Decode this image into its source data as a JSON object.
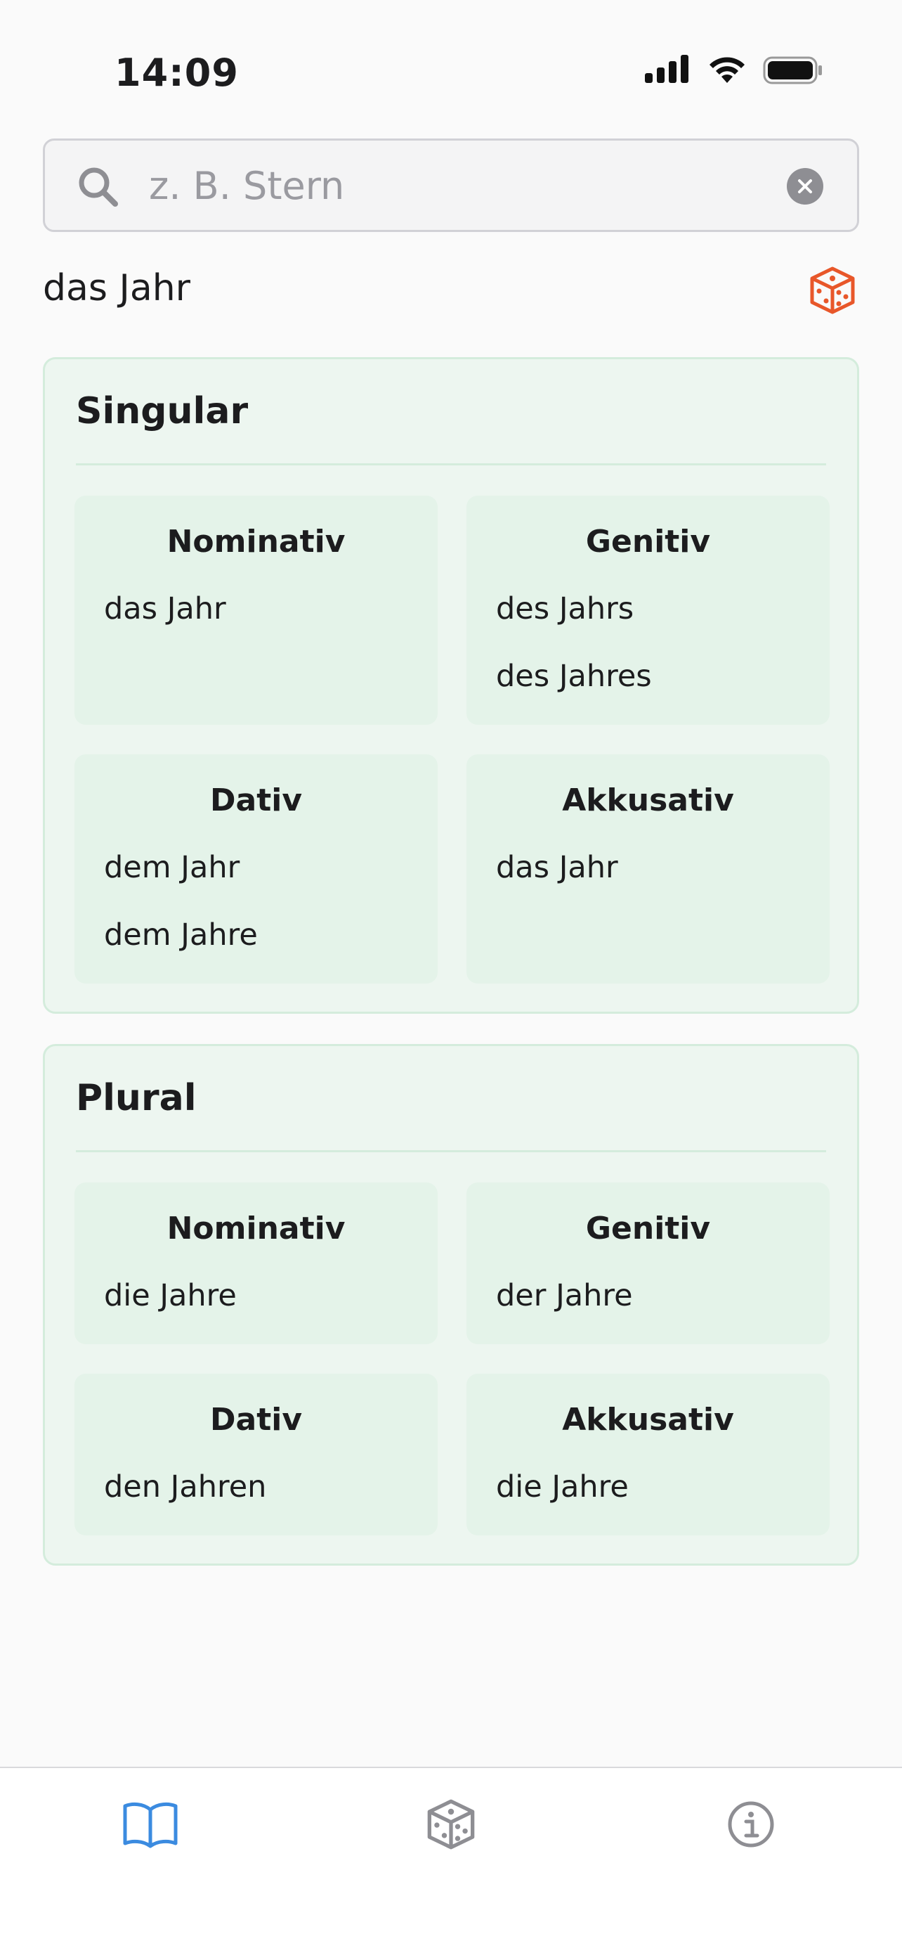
{
  "status_bar": {
    "time": "14:09"
  },
  "search": {
    "placeholder": "z. B. Stern",
    "value": ""
  },
  "word": {
    "title": "das Jahr"
  },
  "colors": {
    "accent": "#e8572a",
    "tab_active": "#3b8be0",
    "tab_inactive": "#8e8e93",
    "card_bg": "#edf6f0",
    "cell_bg": "#e4f3e9"
  },
  "singular": {
    "title": "Singular",
    "nominativ": {
      "label": "Nominativ",
      "forms": [
        "das Jahr"
      ]
    },
    "genitiv": {
      "label": "Genitiv",
      "forms": [
        "des Jahrs",
        "des Jahres"
      ]
    },
    "dativ": {
      "label": "Dativ",
      "forms": [
        "dem Jahr",
        "dem Jahre"
      ]
    },
    "akkusativ": {
      "label": "Akkusativ",
      "forms": [
        "das Jahr"
      ]
    }
  },
  "plural": {
    "title": "Plural",
    "nominativ": {
      "label": "Nominativ",
      "forms": [
        "die Jahre"
      ]
    },
    "genitiv": {
      "label": "Genitiv",
      "forms": [
        "der Jahre"
      ]
    },
    "dativ": {
      "label": "Dativ",
      "forms": [
        "den Jahren"
      ]
    },
    "akkusativ": {
      "label": "Akkusativ",
      "forms": [
        "die Jahre"
      ]
    }
  },
  "tabs": [
    {
      "icon": "book-icon",
      "active": true
    },
    {
      "icon": "dice-icon",
      "active": false
    },
    {
      "icon": "info-icon",
      "active": false
    }
  ]
}
